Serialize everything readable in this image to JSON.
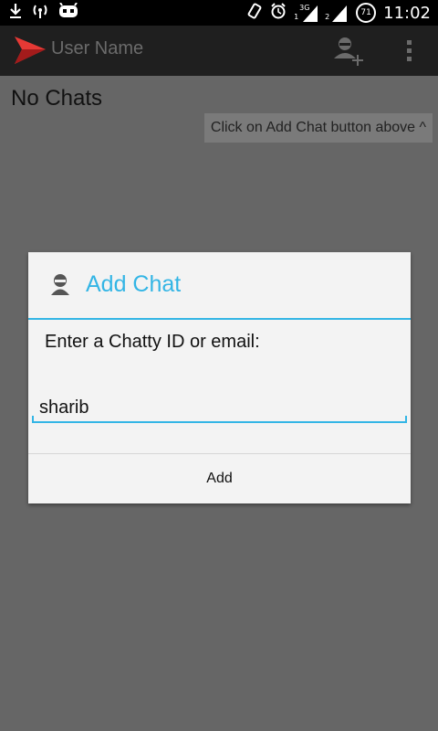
{
  "status_bar": {
    "icons": [
      "download-icon",
      "wifi-tether-icon",
      "cyanogen-icon",
      "vibrate-icon",
      "alarm-icon",
      "signal-3g-icon",
      "signal-2-icon",
      "battery-icon"
    ],
    "network_type": "3G",
    "sim_1": "1",
    "sim_2": "2",
    "battery_level": "71",
    "time": "11:02"
  },
  "action_bar": {
    "title": "User Name",
    "icons": [
      "app-logo-icon",
      "add-user-icon",
      "overflow-menu-icon"
    ]
  },
  "main": {
    "empty_text": "No Chats",
    "hint_text": "Click on Add Chat button above ^"
  },
  "dialog": {
    "title": "Add Chat",
    "title_icon": "user-icon",
    "prompt": "Enter a Chatty ID or email:",
    "input_value": "sharib",
    "button_label": "Add"
  },
  "colors": {
    "accent": "#33b5e5",
    "logo_red": "#e53935",
    "dim_overlay": "#666666",
    "action_bar": "#1f1f1f"
  }
}
